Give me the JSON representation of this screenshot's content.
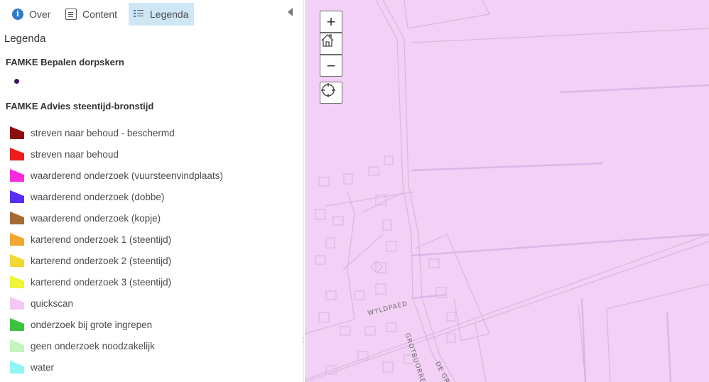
{
  "tabs": [
    {
      "label": "Over",
      "icon": "info-icon"
    },
    {
      "label": "Content",
      "icon": "content-icon"
    },
    {
      "label": "Legenda",
      "icon": "legend-icon",
      "active": true
    }
  ],
  "legend": {
    "title": "Legenda",
    "layers": [
      {
        "title": "FAMKE Bepalen dorpskern",
        "symbol_color": "#3d1660"
      },
      {
        "title": "FAMKE Advies steentijd-bronstijd",
        "items": [
          {
            "label": "streven naar behoud - beschermd",
            "color": "#8b0f0f"
          },
          {
            "label": "streven naar behoud",
            "color": "#ee1c1c"
          },
          {
            "label": "waarderend onderzoek (vuursteenvindplaats)",
            "color": "#f72ae0"
          },
          {
            "label": "waarderend onderzoek (dobbe)",
            "color": "#5a2df5"
          },
          {
            "label": "waarderend onderzoek (kopje)",
            "color": "#a66a35"
          },
          {
            "label": "karterend onderzoek 1 (steentijd)",
            "color": "#f0a830"
          },
          {
            "label": "karterend onderzoek 2 (steentijd)",
            "color": "#f2d835"
          },
          {
            "label": "karterend onderzoek 3 (steentijd)",
            "color": "#eef53a"
          },
          {
            "label": "quickscan",
            "color": "#f3c8f5"
          },
          {
            "label": "onderzoek bij grote ingrepen",
            "color": "#3cc23c"
          },
          {
            "label": "geen onderzoek noodzakelijk",
            "color": "#c3f5c0"
          },
          {
            "label": "water",
            "color": "#90f5f5"
          }
        ]
      }
    ]
  },
  "map": {
    "background_color": "#f3d0f6",
    "street_labels": [
      "WYLDPAED",
      "GROTBUORREN",
      "DE GR"
    ],
    "controls": {
      "zoom_in": "+",
      "zoom_out": "−"
    }
  }
}
